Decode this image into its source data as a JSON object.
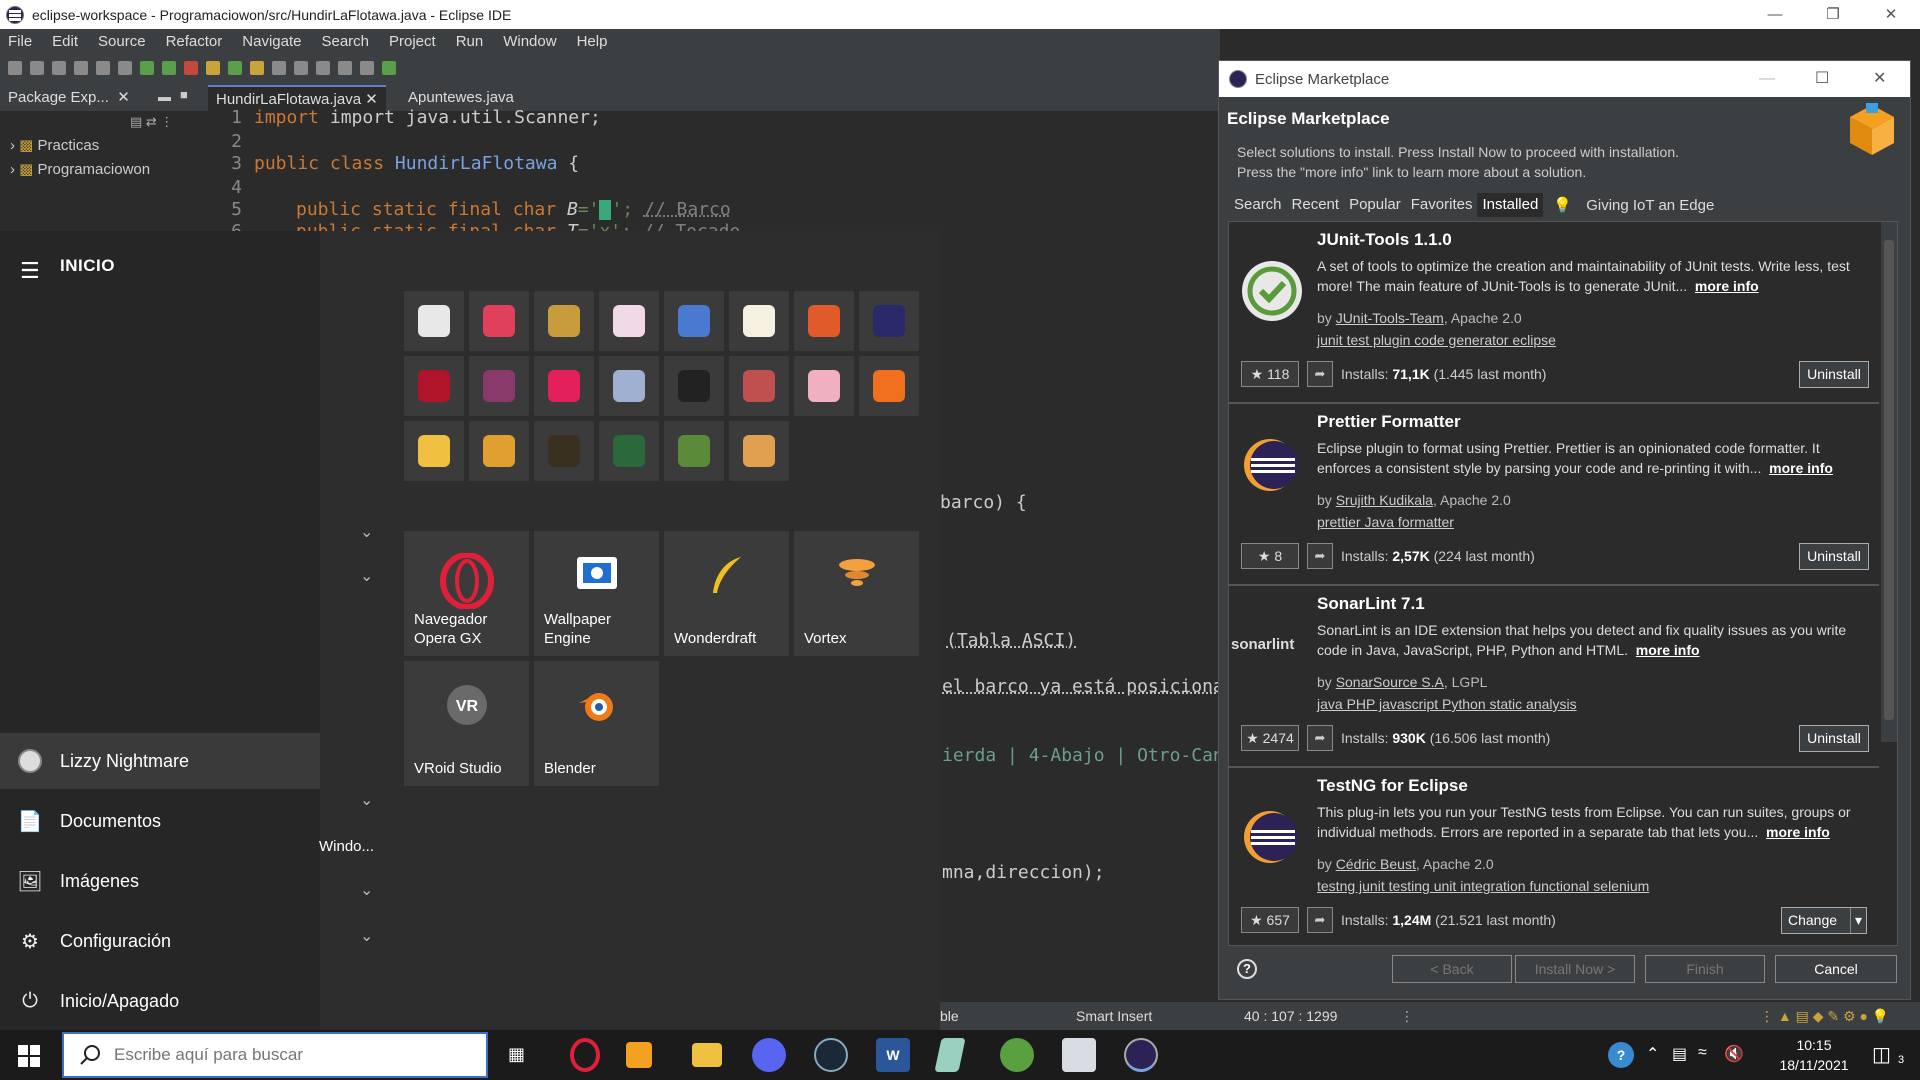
{
  "eclipse": {
    "title": "eclipse-workspace - Programaciowon/src/HundirLaFlotawa.java - Eclipse IDE",
    "menu": [
      "File",
      "Edit",
      "Source",
      "Refactor",
      "Navigate",
      "Search",
      "Project",
      "Run",
      "Window",
      "Help"
    ],
    "tabs": {
      "package_explorer": "Package Exp...",
      "editor_tab_1": "HundirLaFlotawa.java",
      "editor_tab_2": "Apuntewes.java"
    },
    "tree": [
      "Practicas",
      "Programaciowon"
    ],
    "code": {
      "l1_num": "1",
      "l1": "import java.util.Scanner;",
      "l2_num": "2",
      "l3_num": "3",
      "l3_kw": "public class ",
      "l3_cls": "HundirLaFlotawa",
      "l3_rest": " {",
      "l4_num": "4",
      "l5_num": "5",
      "l5_kw": "public static final char ",
      "l5_var": "B",
      "l5_rest": "='",
      "l5_after": "'; ",
      "l5_comment": "// Barco",
      "l6_num": "6",
      "l6_kw": "public static final char ",
      "l6_var": "T",
      "l6_rest": "='x'; ",
      "l6_comment": "// Tocado",
      "frag_barco": "barco) {",
      "frag_tabla": "(Tabla ASCI)",
      "frag_posicion": "el barco ya está posiciona",
      "frag_izq": "ierda | 4-Abajo | Otro-Can",
      "frag_dir": "mna,direccion);"
    },
    "status": {
      "writable": "ble",
      "insert_mode": "Smart Insert",
      "position": "40 : 107 : 1299"
    }
  },
  "start_menu": {
    "header": "INICIO",
    "user": "Lizzy Nightmare",
    "items": [
      "Documentos",
      "Imágenes",
      "Configuración",
      "Inicio/Apagado"
    ],
    "group_label": "Windo...",
    "large_tiles": [
      {
        "line1": "Navegador",
        "line2": "Opera GX"
      },
      {
        "line1": "Wallpaper",
        "line2": "Engine"
      },
      {
        "line1": "",
        "line2": "Wonderdraft"
      },
      {
        "line1": "",
        "line2": "Vortex"
      },
      {
        "line1": "",
        "line2": "VRoid Studio"
      },
      {
        "line1": "",
        "line2": "Blender"
      }
    ],
    "small_tile_colors": [
      "#e8e8e8",
      "#e0405a",
      "#c89b3c",
      "#f2d9e8",
      "#4a7ad0",
      "#f5f0e0",
      "#e05a2a",
      "#2a2a6a",
      "#b0142a",
      "#8a3a6a",
      "#e4205a",
      "#a0b0d0",
      "#222222",
      "#c05050",
      "#f0b0c0",
      "#f07020",
      "#f0c040",
      "#e0a030",
      "#3a3020",
      "#2a6a3a",
      "#5a8a3a",
      "#e0a050"
    ]
  },
  "marketplace": {
    "window_title": "Eclipse Marketplace",
    "heading": "Eclipse Marketplace",
    "desc1": "Select solutions to install. Press Install Now to proceed with installation.",
    "desc2": "Press the \"more info\" link to learn more about a solution.",
    "tabs": [
      "Search",
      "Recent",
      "Popular",
      "Favorites",
      "Installed",
      "Giving IoT an Edge"
    ],
    "active_tab": "Installed",
    "entries": [
      {
        "name": "JUnit-Tools 1.1.0",
        "desc": "A set of tools to optimize the creation and maintainability of JUnit tests. Write less, test more! The main feature of JUnit-Tools is to generate JUnit...",
        "more": "more info",
        "author": "JUnit-Tools-Team",
        "license": ", Apache 2.0",
        "tags": "junit test plugin code generator eclipse",
        "stars": "118",
        "installs_label": "Installs: ",
        "installs": "71,1K",
        "installs_month": " (1.445 last month)",
        "action": "Uninstall"
      },
      {
        "name": "Prettier Formatter",
        "desc": "Eclipse plugin to format using Prettier. Prettier is an opinionated code formatter. It enforces a consistent style by parsing your code and re-printing it with...",
        "more": "more info",
        "author": "Srujith Kudikala",
        "license": ", Apache 2.0",
        "tags": "prettier Java formatter",
        "stars": "8",
        "installs_label": "Installs: ",
        "installs": "2,57K",
        "installs_month": " (224 last month)",
        "action": "Uninstall"
      },
      {
        "name": "SonarLint 7.1",
        "desc": "SonarLint is an IDE extension that helps you detect and fix quality issues as you write code in Java, JavaScript, PHP, Python and HTML.",
        "more": "more info",
        "author": "SonarSource S.A",
        "license": ", LGPL",
        "tags": "java PHP javascript Python static analysis",
        "stars": "2474",
        "installs_label": "Installs: ",
        "installs": "930K",
        "installs_month": " (16.506 last month)",
        "action": "Uninstall",
        "logo_text": "sonarlint"
      },
      {
        "name": "TestNG for Eclipse",
        "desc": "This plug-in lets you run your TestNG tests from Eclipse. You can run suites, groups or individual methods. Errors are reported in a separate tab that lets you...",
        "more": "more info",
        "author": "Cédric Beust",
        "license": ", Apache 2.0",
        "tags": "testng junit testing unit integration functional selenium",
        "stars": "657",
        "installs_label": "Installs: ",
        "installs": "1,24M",
        "installs_month": " (21.521 last month)",
        "action": "Change"
      }
    ],
    "buttons": {
      "back": "< Back",
      "install": "Install Now >",
      "finish": "Finish",
      "cancel": "Cancel"
    }
  },
  "taskbar": {
    "search_placeholder": "Escribe aquí para buscar",
    "time": "10:15",
    "date": "18/11/2021",
    "notification_count": "3"
  }
}
